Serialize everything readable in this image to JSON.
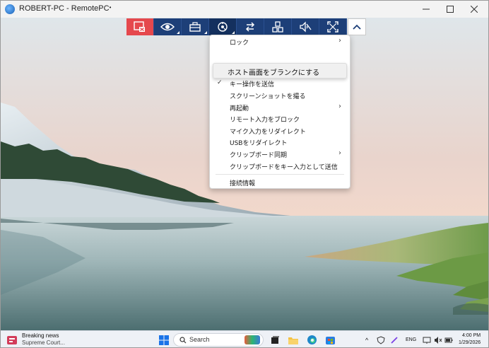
{
  "window": {
    "title": "ROBERT-PC - RemotePC",
    "title_suffix": "•",
    "controls": [
      "minimize",
      "maximize",
      "close"
    ]
  },
  "toolbar": {
    "buttons": [
      {
        "name": "end-session",
        "icon": "disconnect-icon",
        "color": "#e5484d"
      },
      {
        "name": "view",
        "icon": "eye-icon",
        "has_dropdown": true
      },
      {
        "name": "tools",
        "icon": "toolbox-icon",
        "has_dropdown": true
      },
      {
        "name": "actions",
        "icon": "settings-icon",
        "has_dropdown": true,
        "active": true
      },
      {
        "name": "transfer",
        "icon": "transfer-arrows-icon"
      },
      {
        "name": "apps",
        "icon": "apps-grid-icon"
      },
      {
        "name": "sound",
        "icon": "speaker-mute-icon"
      },
      {
        "name": "fullscreen",
        "icon": "fullscreen-icon"
      },
      {
        "name": "collapse",
        "icon": "chevron-up-icon"
      }
    ]
  },
  "menu": {
    "items": [
      {
        "label": "ロック",
        "has_submenu": true
      },
      {
        "label": "キー操作を送信",
        "checked": true
      },
      {
        "label": "スクリーンショットを撮る"
      },
      {
        "label": "再起動",
        "has_submenu": true
      },
      {
        "label": "リモート入力をブロック"
      },
      {
        "label": "マイク入力をリダイレクト"
      },
      {
        "label": "USBをリダイレクト"
      },
      {
        "label": "クリップボード同期",
        "has_submenu": true
      },
      {
        "label": "クリップボードをキー入力として送信"
      },
      {
        "label": "接続情報"
      }
    ],
    "tooltip": "ホスト画面をブランクにする",
    "submenu_arrow": "›",
    "check_mark": "✓"
  },
  "taskbar": {
    "news_title": "Breaking news",
    "news_subtitle": "Supreme Court...",
    "search_placeholder": "Search",
    "tray_language": "ENG",
    "clock_time": "4:00 PM",
    "clock_date": "1/29/2026",
    "overflow_arrow": "^"
  },
  "colors": {
    "toolbar": "#1d3f78",
    "toolbar_active": "#14305e",
    "end_session": "#e5484d"
  }
}
